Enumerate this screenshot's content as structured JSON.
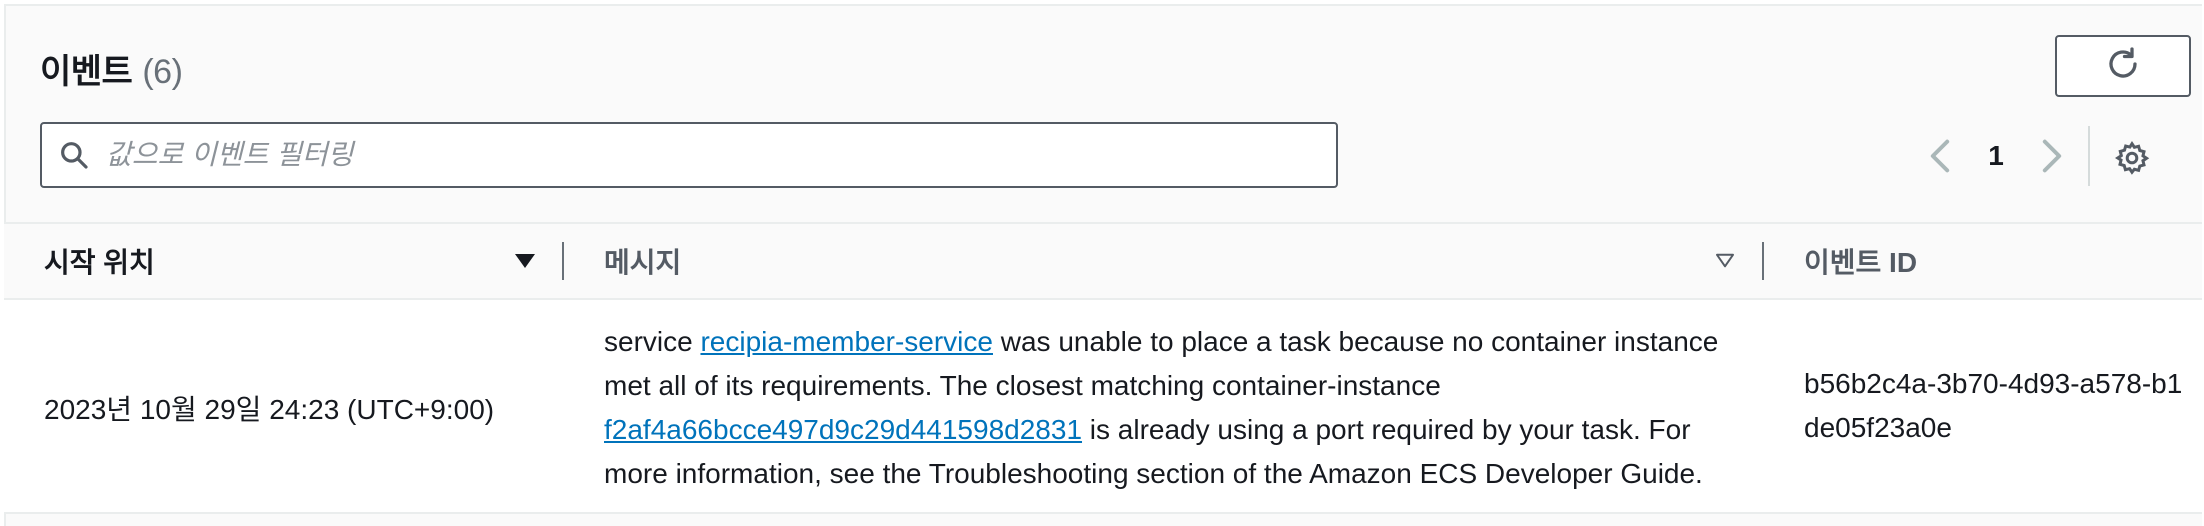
{
  "header": {
    "title": "이벤트",
    "count": "(6)",
    "refresh_icon": "refresh-icon"
  },
  "search": {
    "placeholder": "값으로 이벤트 필터링",
    "value": "",
    "icon": "search-icon"
  },
  "pagination": {
    "current_page": "1",
    "prev_icon": "chevron-left-icon",
    "next_icon": "chevron-right-icon",
    "settings_icon": "gear-icon"
  },
  "table": {
    "columns": [
      {
        "label": "시작 위치",
        "sort": "descending"
      },
      {
        "label": "메시지",
        "sort": "sortable"
      },
      {
        "label": "이벤트 ID"
      }
    ],
    "rows": [
      {
        "start_time": "2023년 10월 29일 24:23 (UTC+9:00)",
        "message": {
          "part1": "service ",
          "service_link": "recipia-member-service",
          "part2": " was unable to place a task because no container instance met all of its requirements. The closest matching container-instance ",
          "instance_link": "f2af4a66bcce497d9c29d441598d2831",
          "part3": " is already using a port required by your task. For more information, see the Troubleshooting section of the Amazon ECS Developer Guide."
        },
        "event_id": "b56b2c4a-3b70-4d93-a578-b1de05f23a0e"
      }
    ]
  },
  "colors": {
    "link": "#0073bb",
    "text": "#16191f",
    "muted": "#687078",
    "border": "#545b64"
  }
}
